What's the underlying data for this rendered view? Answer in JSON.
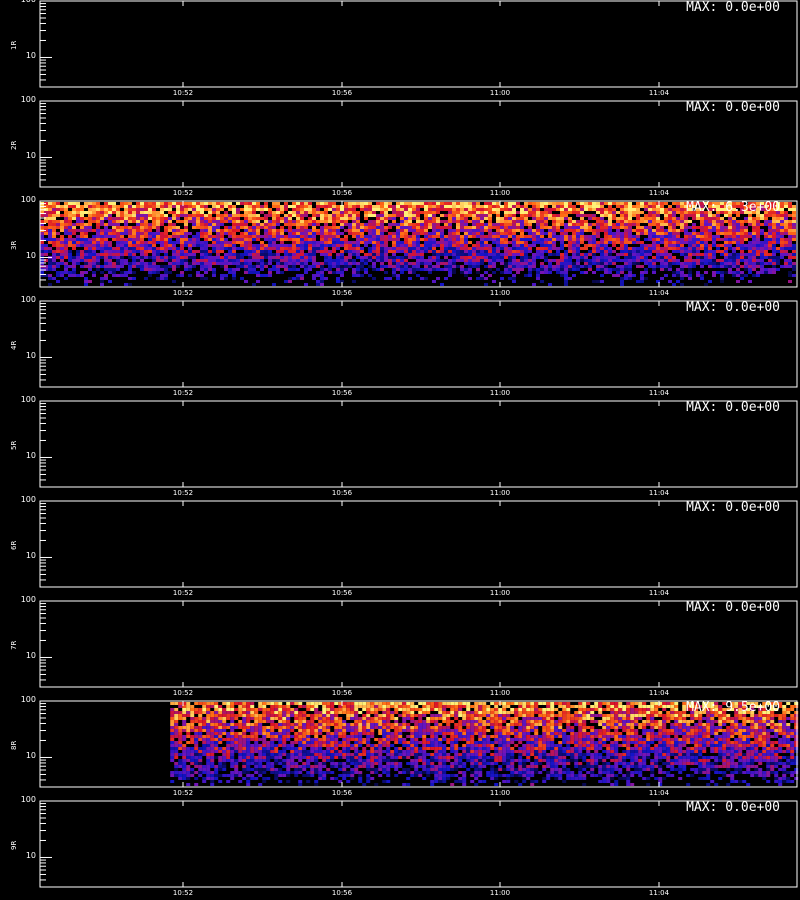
{
  "colors": {
    "background": "#000000",
    "axes": "#ffffff"
  },
  "x_ticks": [
    "10:52",
    "10:56",
    "11:00",
    "11:04"
  ],
  "y_ticks": [
    "100",
    "10"
  ],
  "footer": "",
  "chart_data": [
    {
      "type": "heatmap",
      "ylabel": "1R",
      "max_label": "MAX: 0.0e+00",
      "ylim": [
        3,
        100
      ],
      "yscale": "log",
      "data_present": false
    },
    {
      "type": "heatmap",
      "ylabel": "2R",
      "max_label": "MAX: 0.0e+00",
      "ylim": [
        3,
        100
      ],
      "yscale": "log",
      "data_present": false
    },
    {
      "type": "heatmap",
      "ylabel": "3R",
      "max_label": "MAX: 6.3e+00",
      "ylim": [
        3,
        100
      ],
      "yscale": "log",
      "data_present": true,
      "data_start_fraction": 0.0,
      "data_bottom_value": 5
    },
    {
      "type": "heatmap",
      "ylabel": "4R",
      "max_label": "MAX: 0.0e+00",
      "ylim": [
        3,
        100
      ],
      "yscale": "log",
      "data_present": false
    },
    {
      "type": "heatmap",
      "ylabel": "5R",
      "max_label": "MAX: 0.0e+00",
      "ylim": [
        3,
        100
      ],
      "yscale": "log",
      "data_present": false
    },
    {
      "type": "heatmap",
      "ylabel": "6R",
      "max_label": "MAX: 0.0e+00",
      "ylim": [
        3,
        100
      ],
      "yscale": "log",
      "data_present": false
    },
    {
      "type": "heatmap",
      "ylabel": "7R",
      "max_label": "MAX: 0.0e+00",
      "ylim": [
        3,
        100
      ],
      "yscale": "log",
      "data_present": false
    },
    {
      "type": "heatmap",
      "ylabel": "8R",
      "max_label": "MAX: 9.5e+00",
      "ylim": [
        3,
        100
      ],
      "yscale": "log",
      "data_present": true,
      "data_start_fraction": 0.172,
      "data_bottom_value": 4
    },
    {
      "type": "heatmap",
      "ylabel": "9R",
      "max_label": "MAX: 0.0e+00",
      "ylim": [
        3,
        100
      ],
      "yscale": "log",
      "data_present": false
    }
  ]
}
